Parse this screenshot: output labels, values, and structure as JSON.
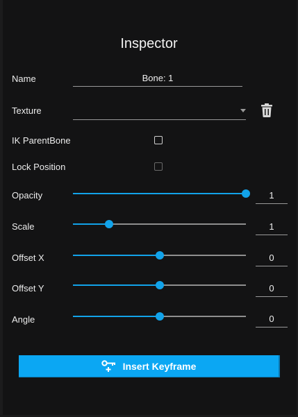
{
  "title": "Inspector",
  "fields": {
    "name_label": "Name",
    "name_value": "Bone: 1",
    "texture_label": "Texture",
    "texture_value": "",
    "ik_parent_label": "IK ParentBone",
    "ik_parent_checked": false,
    "lock_position_label": "Lock Position",
    "lock_position_checked": false,
    "lock_position_disabled": true
  },
  "sliders": [
    {
      "label": "Opacity",
      "value": "1",
      "fraction": 1.0
    },
    {
      "label": "Scale",
      "value": "1",
      "fraction": 0.21
    },
    {
      "label": "Offset X",
      "value": "0",
      "fraction": 0.5
    },
    {
      "label": "Offset Y",
      "value": "0",
      "fraction": 0.5
    },
    {
      "label": "Angle",
      "value": "0",
      "fraction": 0.5
    }
  ],
  "actions": {
    "insert_keyframe_label": "Insert Keyframe"
  },
  "icons": {
    "texture_delete": "trash-icon",
    "texture_dropdown": "caret-down-icon",
    "insert_keyframe": "key-plus-icon"
  },
  "colors": {
    "accent": "#12a3ea",
    "button": "#0ba7f3",
    "background": "#131314"
  }
}
